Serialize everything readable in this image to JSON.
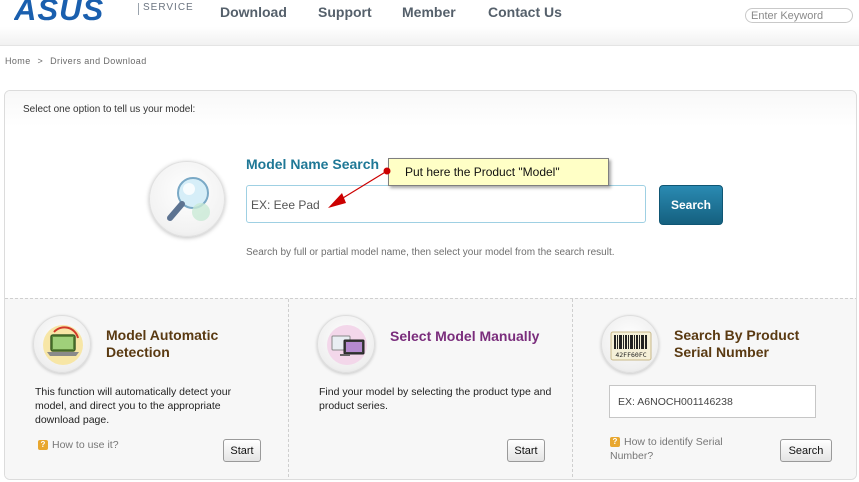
{
  "header": {
    "logo_text": "ASUS",
    "service_label": "SERVICE",
    "nav": [
      "Download",
      "Support",
      "Member",
      "Contact Us"
    ],
    "search_placeholder": "Enter Keyword"
  },
  "breadcrumb": [
    "Home",
    ">",
    "Drivers and Download"
  ],
  "panel": {
    "intro": "Select one option to tell us your model:"
  },
  "model_search": {
    "title": "Model Name Search",
    "placeholder": "EX: Eee Pad",
    "button_label": "Search",
    "hint": "Search by full or partial model name, then select your model from the search result.",
    "annotation": "Put here the Product \"Model\""
  },
  "options": {
    "auto": {
      "title_line1": "Model Automatic",
      "title_line2": "Detection",
      "description": "This function will automatically detect your model, and direct you to the appropriate download page.",
      "help_link": "How to use it?",
      "button_label": "Start",
      "title_color": "#5a3a12"
    },
    "manual": {
      "title": "Select Model Manually",
      "description": "Find your model by selecting the product type and product series.",
      "button_label": "Start",
      "title_color": "#7a2d7c"
    },
    "serial": {
      "title_line1": "Search By Product",
      "title_line2": "Serial Number",
      "barcode_text": "42FF60FC",
      "placeholder": "EX: A6NOCH001146238",
      "help_link_line1": "How to identify Serial",
      "help_link_line2": "Number?",
      "button_label": "Search",
      "title_color": "#5a3a12"
    }
  },
  "colors": {
    "brand": "#1a5fae",
    "accent": "#1f7896",
    "search_button": "#15607f",
    "annotation_bg": "#ffffc6",
    "annotation_arrow": "#cc0000"
  }
}
